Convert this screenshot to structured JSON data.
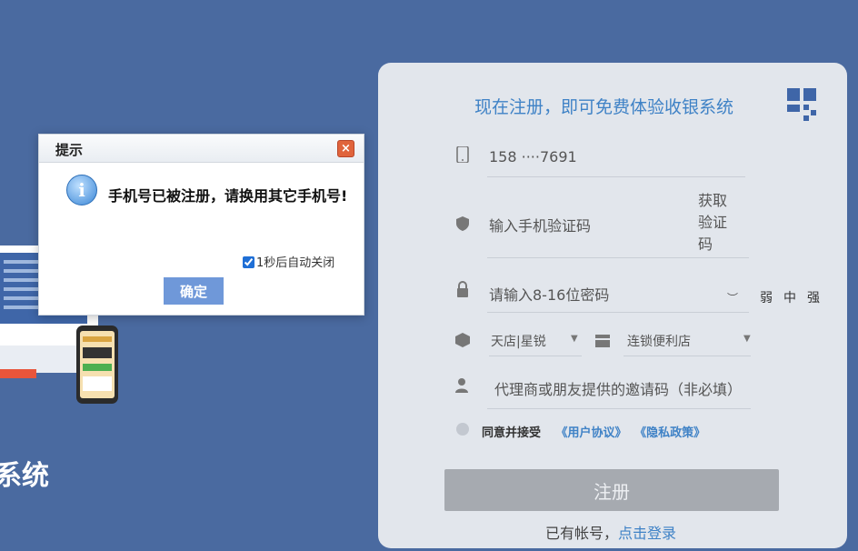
{
  "background": {
    "title_fragment": "系统"
  },
  "register": {
    "heading": "现在注册，即可免费体验收银系统",
    "phone_value": "158 ····7691",
    "sms_placeholder": "输入手机验证码",
    "sms_button": "获取验证码",
    "password_placeholder": "请输入8-16位密码",
    "strength": [
      "弱",
      "中",
      "强"
    ],
    "category_value": "天店|星锐",
    "store_type_value": "连锁便利店",
    "invite_placeholder": "代理商或朋友提供的邀请码（非必填）",
    "agree_text": "同意并接受",
    "user_agreement": "《用户协议》",
    "privacy_policy": "《隐私政策》",
    "submit_label": "注册",
    "login_prefix": "已有帐号，",
    "login_link": "点击登录"
  },
  "dialog": {
    "title": "提示",
    "message": "手机号已被注册，请换用其它手机号!",
    "auto_close_label": "1秒后自动关闭",
    "auto_close_checked": true,
    "ok_label": "确定"
  },
  "colors": {
    "page_bg": "#4a6aa0",
    "accent_blue": "#3f82c6",
    "ok_button": "#6f98d9",
    "close_button": "#e0643c"
  }
}
